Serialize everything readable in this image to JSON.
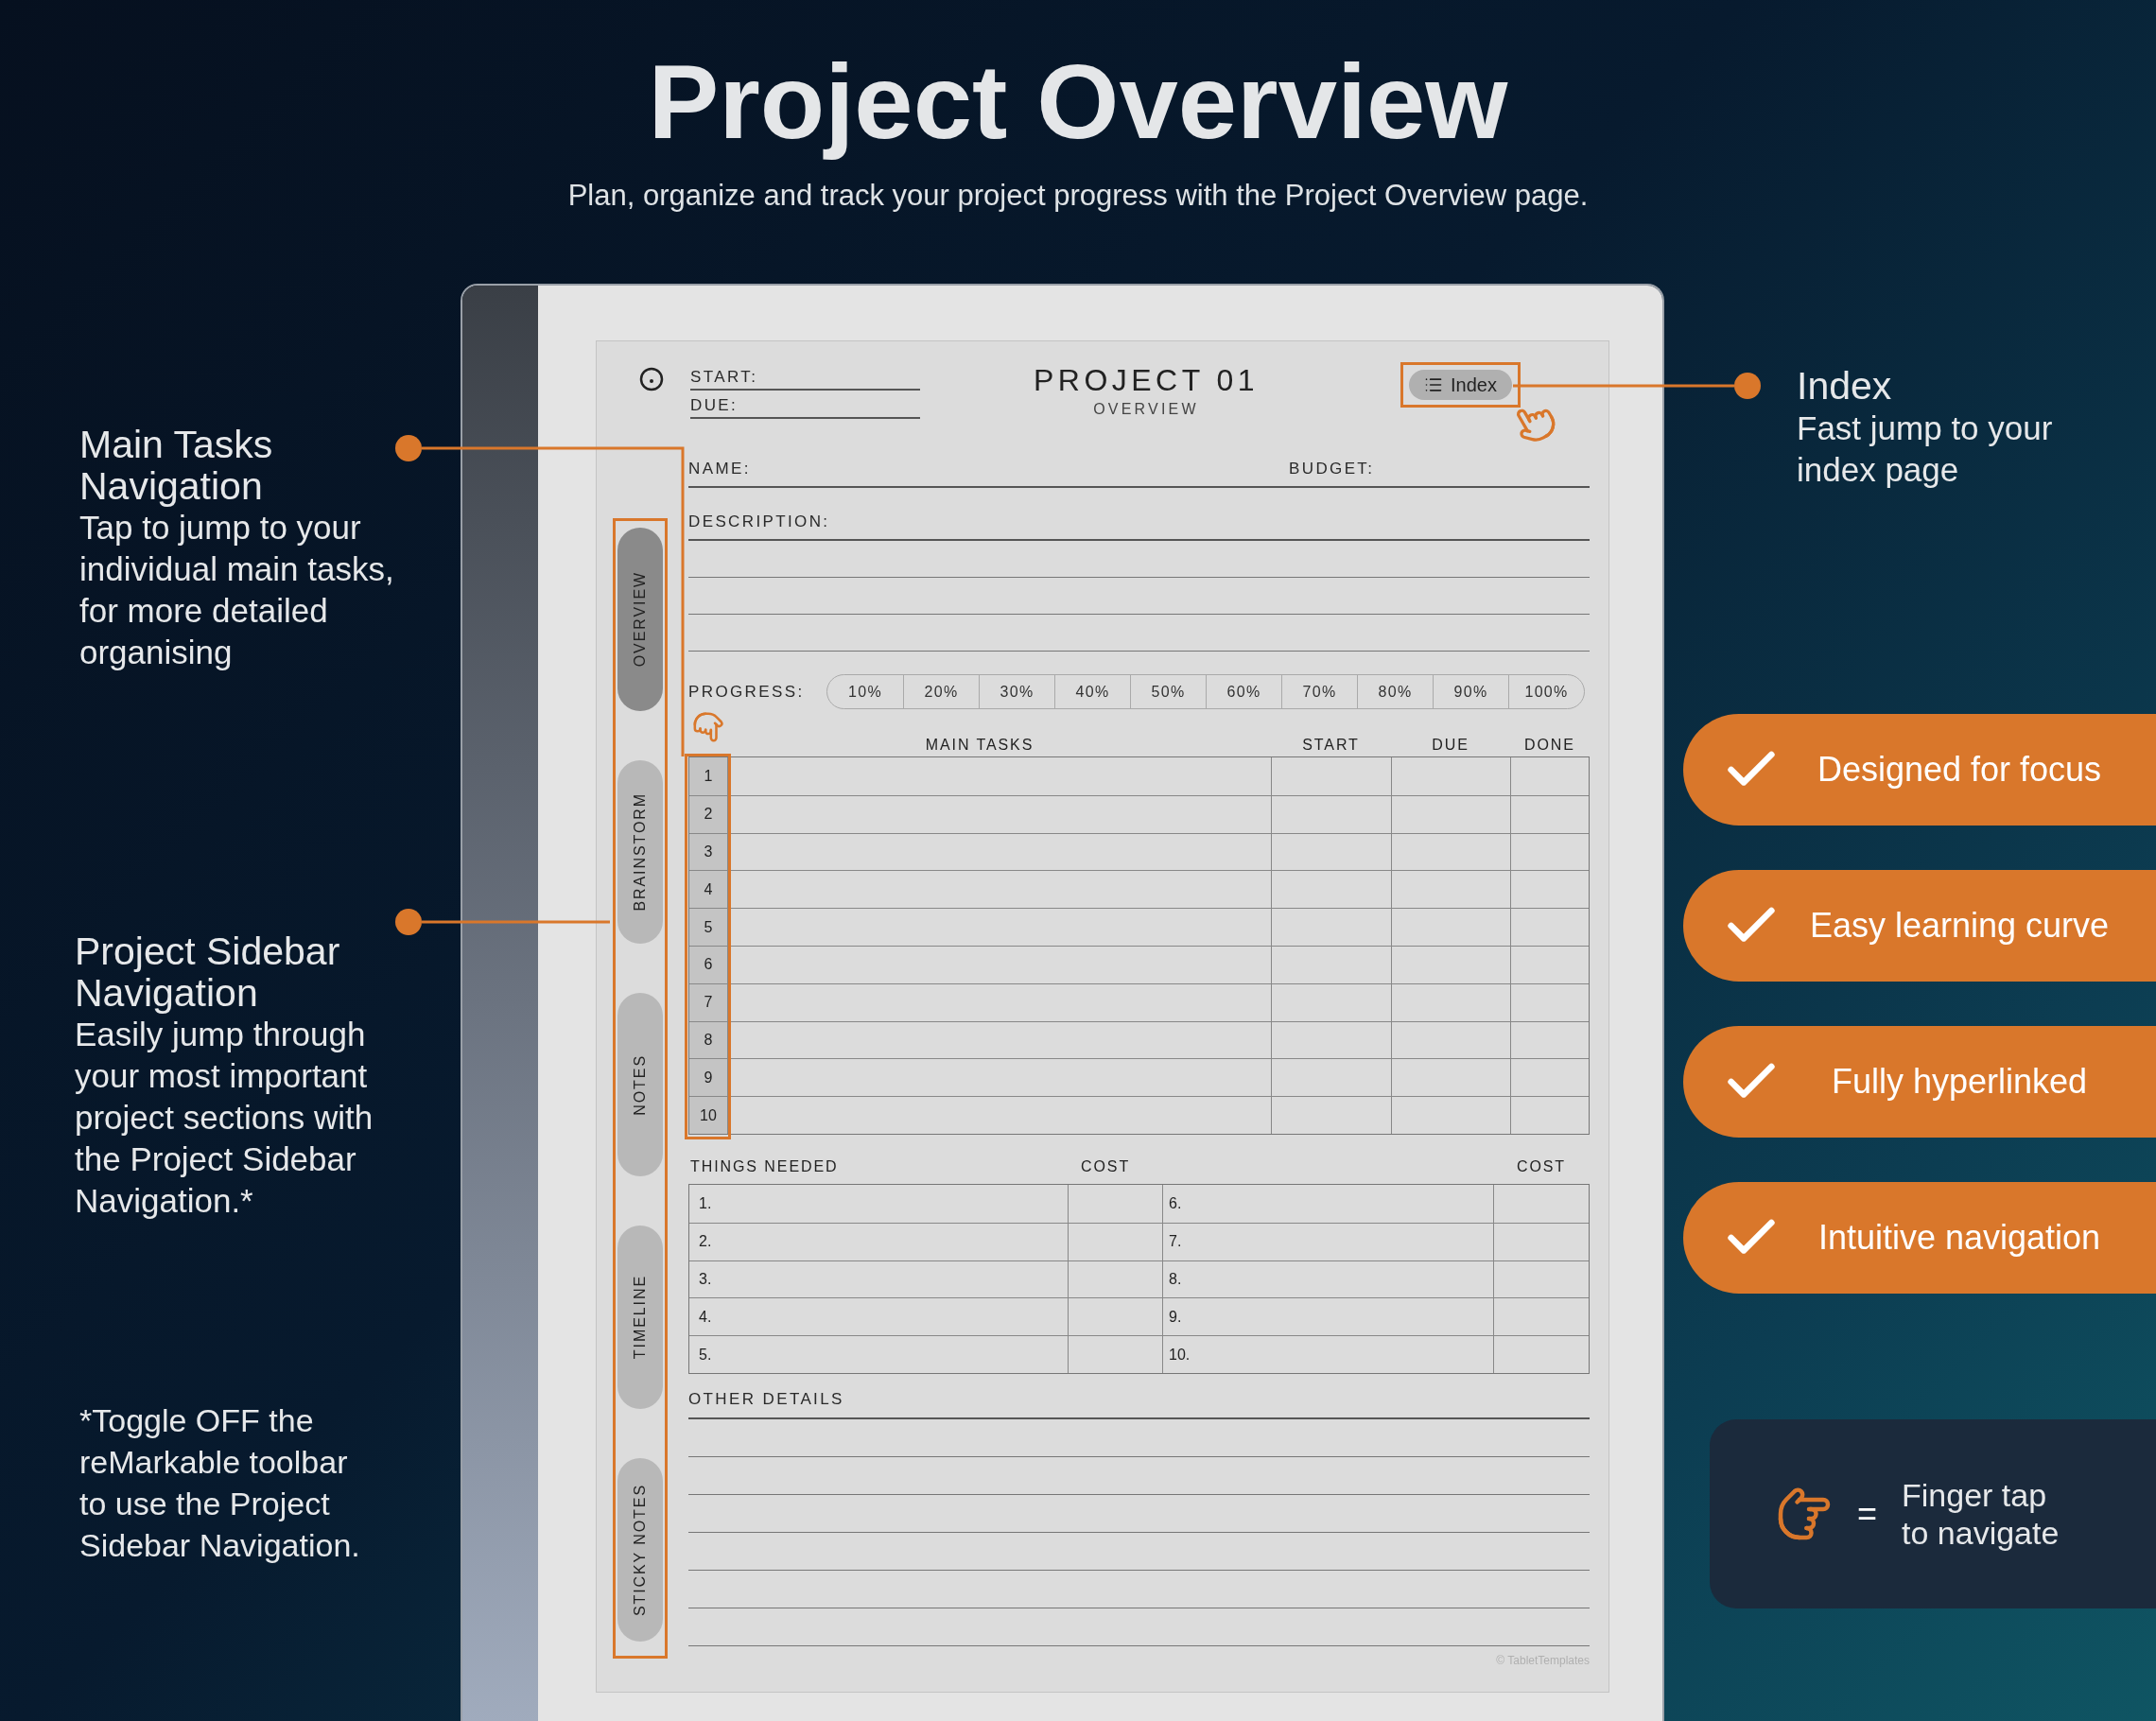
{
  "title": "Project Overview",
  "subtitle": "Plan, organize and track your project progress with the Project Overview page.",
  "callouts": [
    {
      "heading": "Main Tasks Navigation",
      "body": "Tap to jump to your individual main tasks, for more detailed organising"
    },
    {
      "heading": "Project Sidebar Navigation",
      "body": "Easily jump through your most important project sections with the Project Sidebar Navigation.*"
    }
  ],
  "footnote": "*Toggle OFF the reMarkable toolbar to use the Project Sidebar Navigation.",
  "index_callout": {
    "heading": "Index",
    "body": "Fast jump to your index page"
  },
  "features": [
    "Designed for focus",
    "Easy learning curve",
    "Fully hyperlinked",
    "Intuitive navigation"
  ],
  "legend": {
    "symbol": "=",
    "text": "Finger tap to navigate"
  },
  "planner": {
    "title": "PROJECT 01",
    "subtitle": "OVERVIEW",
    "date_fields": [
      "START:",
      "DUE:"
    ],
    "index_button": "Index",
    "name_label": "NAME:",
    "budget_label": "BUDGET:",
    "description_label": "DESCRIPTION:",
    "progress_label": "PROGRESS:",
    "progress_steps": [
      "10%",
      "20%",
      "30%",
      "40%",
      "50%",
      "60%",
      "70%",
      "80%",
      "90%",
      "100%"
    ],
    "sidebar_tabs": [
      {
        "label": "OVERVIEW",
        "selected": true
      },
      {
        "label": "BRAINSTORM",
        "selected": false
      },
      {
        "label": "NOTES",
        "selected": false
      },
      {
        "label": "TIMELINE",
        "selected": false
      },
      {
        "label": "STICKY NOTES",
        "selected": false
      }
    ],
    "tasks": {
      "columns": [
        "MAIN TASKS",
        "START",
        "DUE",
        "DONE"
      ],
      "rows": [
        "1",
        "2",
        "3",
        "4",
        "5",
        "6",
        "7",
        "8",
        "9",
        "10"
      ]
    },
    "things_needed": {
      "columns": [
        "THINGS NEEDED",
        "COST",
        "COST"
      ],
      "left_rows": [
        "1.",
        "2.",
        "3.",
        "4.",
        "5."
      ],
      "right_rows": [
        "6.",
        "7.",
        "8.",
        "9.",
        "10."
      ]
    },
    "other_details_label": "OTHER DETAILS",
    "credit": "© TabletTemplates"
  }
}
